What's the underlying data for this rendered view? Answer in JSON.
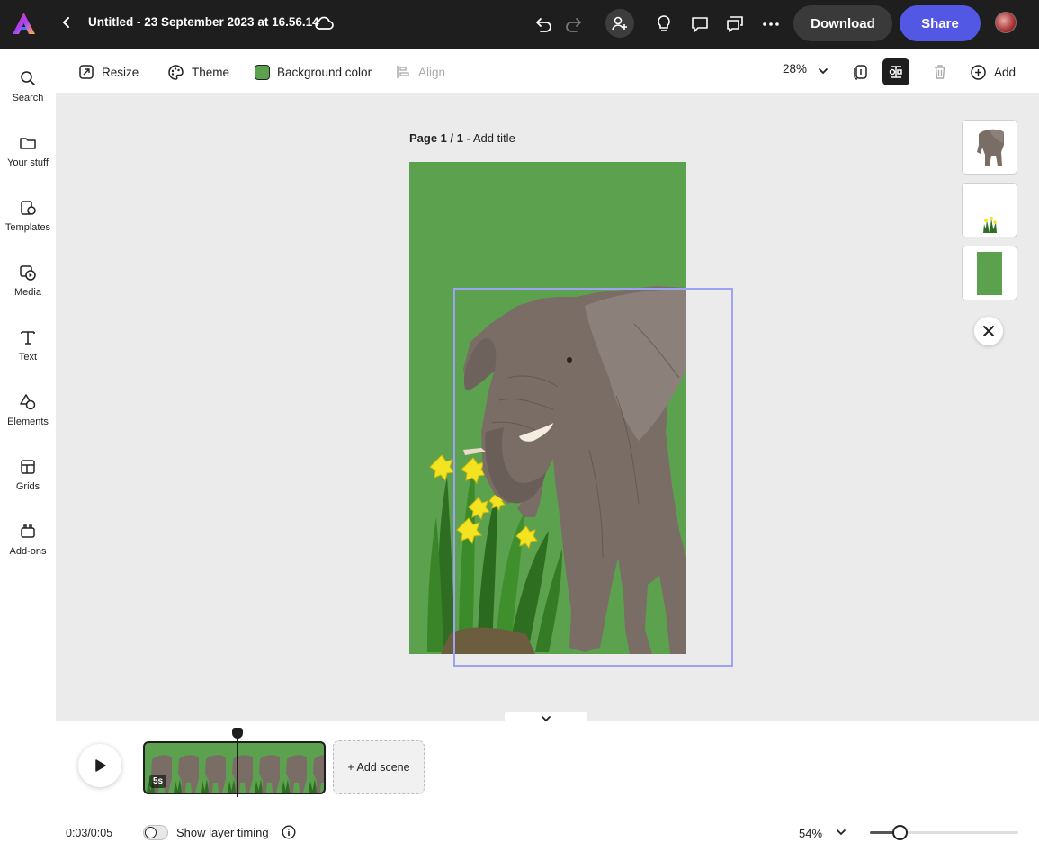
{
  "header": {
    "doc_title": "Untitled - 23 September 2023 at 16.56.14",
    "download_label": "Download",
    "share_label": "Share"
  },
  "rail": {
    "items": [
      {
        "label": "Search",
        "icon": "search-icon"
      },
      {
        "label": "Your stuff",
        "icon": "folder-icon"
      },
      {
        "label": "Templates",
        "icon": "templates-icon"
      },
      {
        "label": "Media",
        "icon": "media-icon"
      },
      {
        "label": "Text",
        "icon": "text-icon"
      },
      {
        "label": "Elements",
        "icon": "elements-icon"
      },
      {
        "label": "Grids",
        "icon": "grids-icon"
      },
      {
        "label": "Add-ons",
        "icon": "addons-icon"
      }
    ]
  },
  "toolbar": {
    "resize_label": "Resize",
    "theme_label": "Theme",
    "bg_color_label": "Background color",
    "bg_color": "#5ca14e",
    "align_label": "Align",
    "zoom": "28%",
    "add_label": "Add"
  },
  "canvas": {
    "page_prefix": "Page 1 / 1 -",
    "page_title_placeholder": "Add title"
  },
  "timeline": {
    "scene_duration": "5s",
    "add_scene_label": "+ Add scene",
    "time": "0:03/0:05",
    "show_layer_timing_label": "Show layer timing",
    "show_layer_timing_on": false,
    "zoom": "54%",
    "zoom_slider_value": 0.2
  },
  "colors": {
    "accent": "#5258e4",
    "selection": "#9da3f2",
    "dark": "#1e1e1e"
  }
}
